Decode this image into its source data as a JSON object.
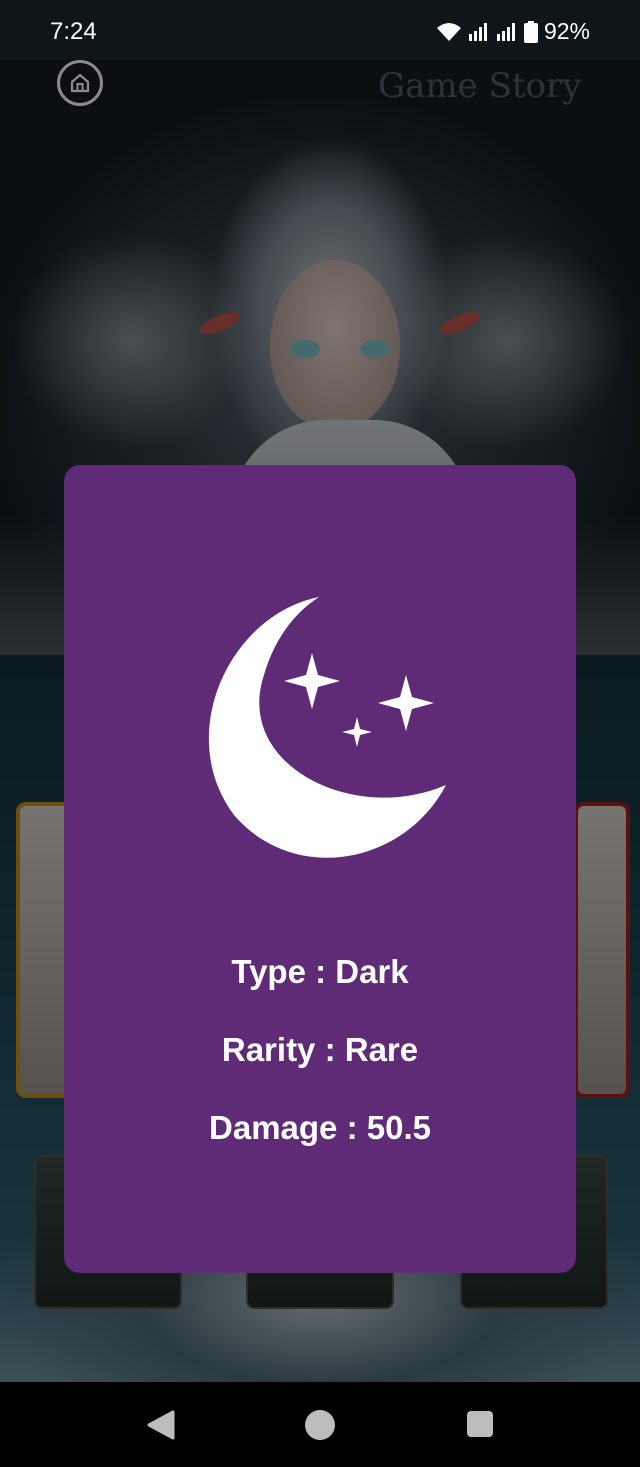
{
  "status_bar": {
    "time": "7:24",
    "battery": "92%",
    "icons": [
      "wifi-icon",
      "signal-icon",
      "signal-icon",
      "battery-icon"
    ]
  },
  "header": {
    "title": "Game Story",
    "home_icon": "home-icon"
  },
  "card_popup": {
    "icon": "crescent-moon-with-stars-icon",
    "type_text": "Type : Dark",
    "rarity_text": "Rarity : Rare",
    "damage_text": "Damage : 50.5",
    "background_color": "#5f2a76"
  },
  "nav_bar": {
    "back_icon": "back-triangle-icon",
    "home_icon": "home-circle-icon",
    "recents_icon": "recents-square-icon"
  }
}
